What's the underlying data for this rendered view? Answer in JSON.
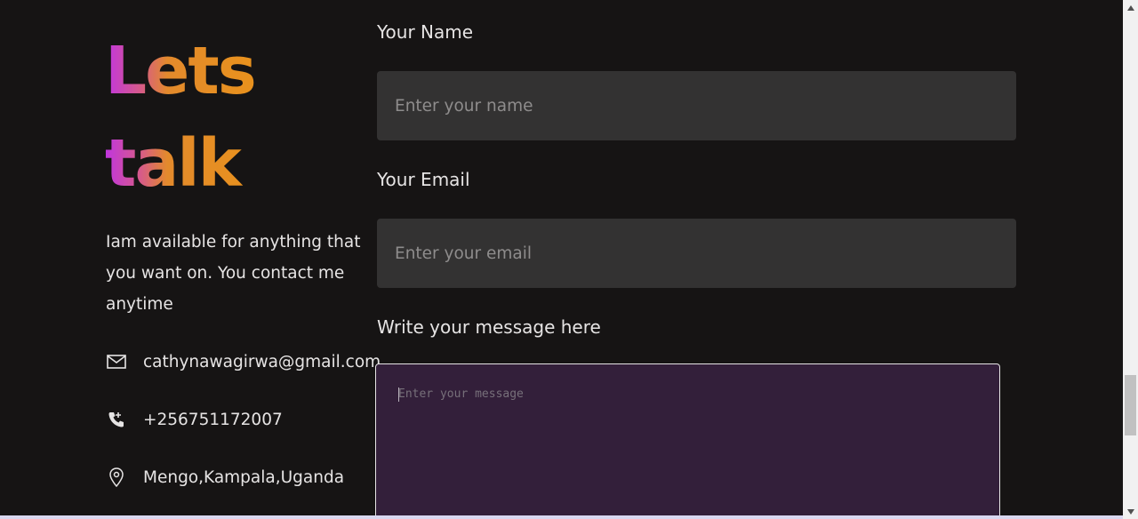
{
  "contact": {
    "heading_line1": "Lets",
    "heading_line2": "talk",
    "intro": "Iam available for anything that you want on. You contact me anytime",
    "email": "cathynawagirwa@gmail.com",
    "phone": "+256751172007",
    "location": "Mengo,Kampala,Uganda",
    "icons": {
      "email": "mail-icon",
      "phone": "phone-call-icon",
      "location": "location-pin-icon"
    }
  },
  "form": {
    "name_label": "Your Name",
    "name_placeholder": "Enter your name",
    "name_value": "",
    "email_label": "Your Email",
    "email_placeholder": "Enter your email",
    "email_value": "",
    "message_label": "Write your message here",
    "message_placeholder": "Enter your message",
    "message_value": ""
  },
  "colors": {
    "background": "#161414",
    "input_bg": "#333232",
    "message_bg": "#331f3a",
    "gradient_start": "#c035e0",
    "gradient_end": "#e8911e"
  }
}
